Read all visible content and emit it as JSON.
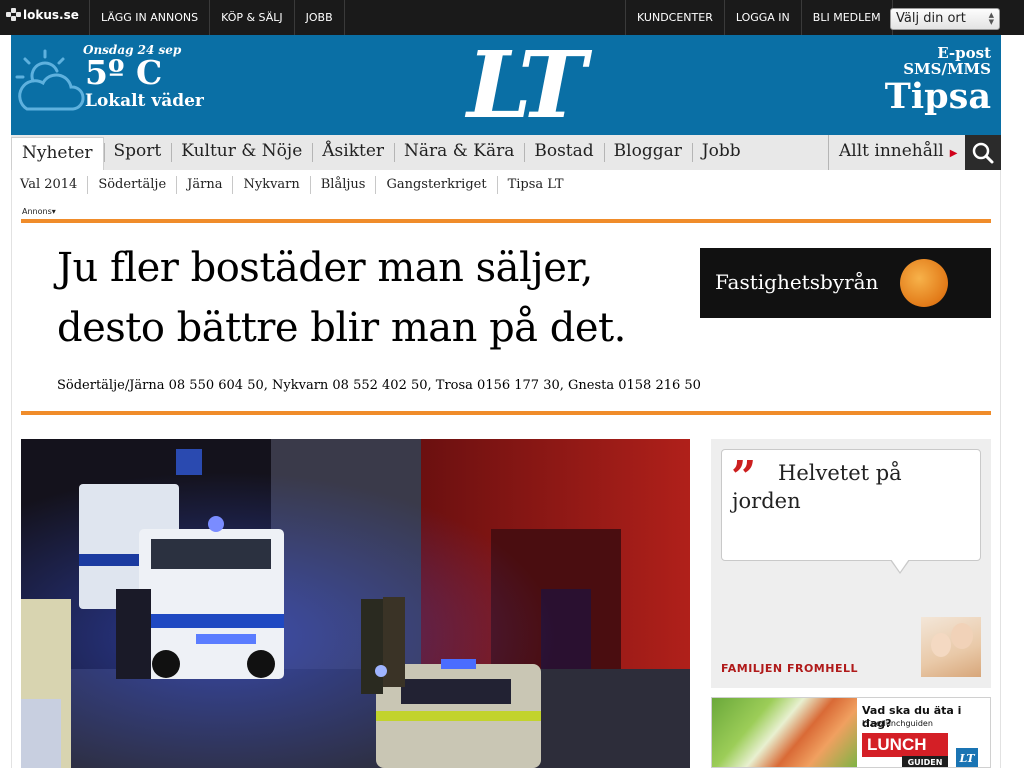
{
  "topbar": {
    "logo": "lokus.se",
    "left_links": [
      "LÄGG IN ANNONS",
      "KÖP & SÄLJ",
      "JOBB"
    ],
    "right_links": [
      "KUNDCENTER",
      "LOGGA IN",
      "BLI MEDLEM"
    ],
    "location_select": {
      "value": "Välj din ort"
    }
  },
  "header": {
    "weather": {
      "date": "Onsdag 24 sep",
      "temp": "5º C",
      "label": "Lokalt väder",
      "icon": "cloud-sun-icon"
    },
    "brand": "LT",
    "tips": {
      "line1": "E-post",
      "line2": "SMS/MMS",
      "line3": "Tipsa"
    },
    "color": "#0a6fa5"
  },
  "mainnav": {
    "items": [
      "Nyheter",
      "Sport",
      "Kultur & Nöje",
      "Åsikter",
      "Nära & Kära",
      "Bostad",
      "Bloggar",
      "Jobb"
    ],
    "active": "Nyheter",
    "all_content": "Allt innehåll",
    "search_icon": "search-icon"
  },
  "subnav": {
    "items": [
      "Val 2014",
      "Södertälje",
      "Järna",
      "Nykvarn",
      "Blåljus",
      "Gangsterkriget",
      "Tipsa LT"
    ]
  },
  "ad": {
    "label": "Annons",
    "headline_line1": "Ju fler bostäder man säljer,",
    "headline_line2": "desto bättre blir man på det.",
    "contact": "Södertälje/Järna 08 550 604 50, Nykvarn 08 552 402 50, Trosa 0156 177 30, Gnesta 0158 216 50",
    "logo_text": "Fastighetsbyrån",
    "rule_color": "#f08c2a"
  },
  "sidebar": {
    "quote_mark": "”",
    "quote_text": "Helvetet på jorden",
    "author": "FAMILJEN FROMHELL",
    "lunch": {
      "question": "Vad ska du äta i dag?",
      "url": "LT.se/lunchguiden",
      "badge": "LUNCH",
      "guide": "GUIDEN",
      "mini_logo": "LT"
    }
  }
}
